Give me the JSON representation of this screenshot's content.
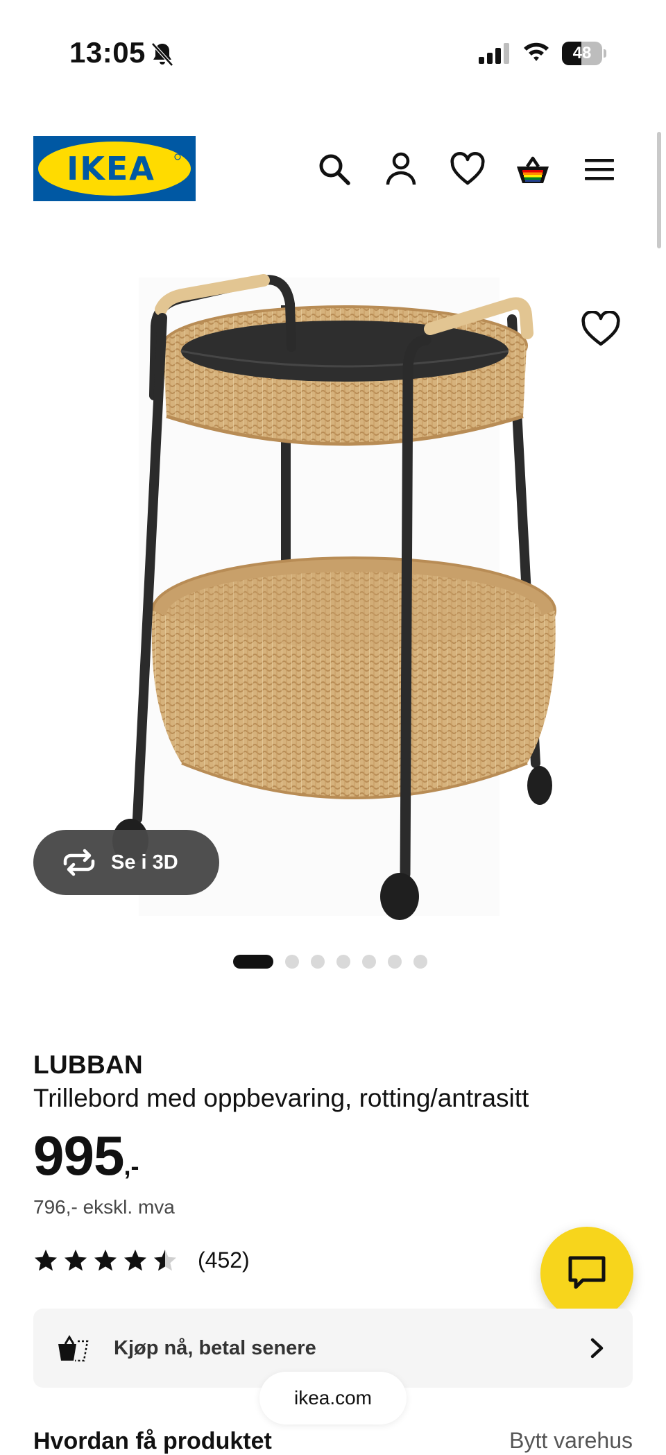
{
  "status_bar": {
    "time": "13:05",
    "battery": "48",
    "battery_level": 0.48
  },
  "header": {
    "logo_text": "IKEA",
    "brand_blue": "#0058a3",
    "brand_yellow": "#ffdb00",
    "icons": [
      "search-icon",
      "account-icon",
      "heart-icon",
      "basket-icon",
      "menu-icon"
    ]
  },
  "gallery": {
    "view_3d_label": "Se i 3D",
    "image_count": 7,
    "active_index": 0
  },
  "product": {
    "name": "LUBBAN",
    "description": "Trillebord med oppbevaring, rotting/antrasitt",
    "price": "995",
    "price_suffix": ",-",
    "price_ex_vat": "796,- ekskl. mva",
    "rating": 4.5,
    "rating_max": 5,
    "review_count": "(452)"
  },
  "payment": {
    "label": "Kjøp nå, betal senere"
  },
  "chat": {
    "accent": "#f7d51c"
  },
  "browser": {
    "url": "ikea.com"
  },
  "delivery": {
    "title": "Hvordan få produktet",
    "change_store": "Bytt varehus"
  }
}
